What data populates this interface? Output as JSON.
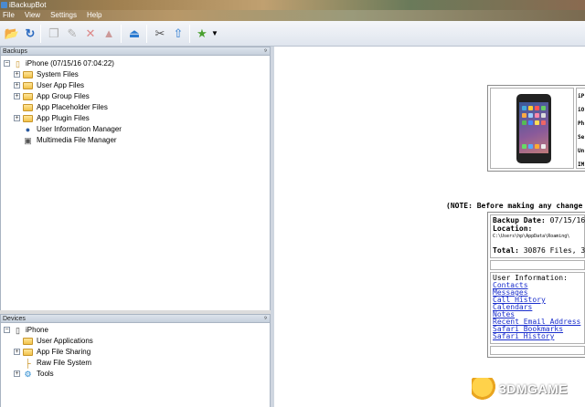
{
  "window": {
    "title": "iBackupBot"
  },
  "menu": [
    "File",
    "View",
    "Settings",
    "Help"
  ],
  "toolbar": {
    "buttons": [
      {
        "icon": "open-folder-icon"
      },
      {
        "icon": "refresh-icon"
      },
      {
        "icon": "copy-icon",
        "disabled": true
      },
      {
        "icon": "clean-icon",
        "disabled": true
      },
      {
        "icon": "delete-icon",
        "disabled": true
      },
      {
        "icon": "eraser-icon",
        "disabled": true
      },
      {
        "icon": "eject-icon"
      },
      {
        "icon": "tools-icon"
      },
      {
        "icon": "upload-icon"
      },
      {
        "icon": "star-icon"
      },
      {
        "icon": "dropdown-icon"
      }
    ]
  },
  "backups_pane": {
    "title": "Backups",
    "root": "iPhone (07/15/16 07:04:22)",
    "items": [
      "System Files",
      "User App Files",
      "App Group Files",
      "App Placeholder Files",
      "App Plugin Files",
      "User Information Manager",
      "Multimedia File Manager"
    ]
  },
  "devices_pane": {
    "title": "Devices",
    "root": "iPhone",
    "items": [
      "User Applications",
      "App File Sharing",
      "Raw File System",
      "Tools"
    ]
  },
  "device_info": {
    "labels": [
      "iP",
      "iO",
      "Ph",
      "Se",
      "Un",
      "IM"
    ]
  },
  "note": "(NOTE: Before making any change",
  "backup_info": {
    "date_label": "Backup Date:",
    "date_value": "07/15/16",
    "location_label": "Location:",
    "location_path": "C:\\Users\\hp\\AppData\\Roaming\\",
    "total_label": "Total:",
    "total_value": "30876 Files, 3.4"
  },
  "user_info": {
    "heading": "User Information:",
    "links": [
      "Contacts",
      "Messages",
      "Call History",
      "Calendars",
      "Notes",
      "Recent Email Address",
      "Safari Bookmarks",
      "Safari History"
    ]
  },
  "watermark": {
    "text": "3DMGAME"
  }
}
